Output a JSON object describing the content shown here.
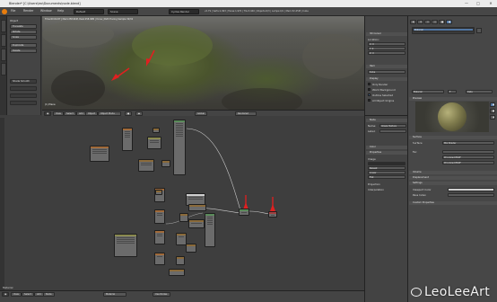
{
  "window": {
    "title": "Blender* [C:\\Users\\leo\\Documents\\node.blend]",
    "minimize": "—",
    "maximize": "□",
    "close": "✕"
  },
  "menubar": {
    "items": [
      "File",
      "Render",
      "Window",
      "Help"
    ],
    "layout": "Default",
    "scene": "Scene",
    "engine": "Cycles Render",
    "stats": "v2.79 | Verts:1,993 | Faces:1,970 | Tris:3,940 | Objects:0/3 | Lamps:0/1 | Mem:32.45M | Cube"
  },
  "tools_panel": {
    "object_label": "Object",
    "buttons": [
      "Translate",
      "Rotate",
      "Scale",
      "Duplicate",
      "Delete"
    ],
    "extra": "Shade Smooth"
  },
  "viewport": {
    "overlay_text": "Time:00:04.87 | Mem:258.96M, Peak:258.96M | Done | Path Tracing Sample 32/32",
    "object_name": "(1) Plane",
    "header": {
      "view": "View",
      "select": "Select",
      "add": "Add",
      "object": "Object",
      "mode": "Object Mode",
      "shading": "Rendered",
      "layers_label": "Global"
    }
  },
  "node_editor": {
    "header": {
      "view": "View",
      "select": "Select",
      "add": "Add",
      "node": "Node",
      "material": "Material",
      "use_nodes": "Use Nodes"
    },
    "bottom_label": "Material"
  },
  "outliner_panel": {
    "title": "3D Cursor",
    "location": "Location:",
    "x": "X: 0",
    "y": "Y: 0",
    "z": "Z: 0",
    "item": "Item",
    "cube": "Cube",
    "display": "Display",
    "only_render": "Only Render",
    "world_bg": "World Background",
    "outline": "Outline Selected",
    "all_edges": "All Object Origins"
  },
  "node_props": {
    "title": "Node",
    "name_label": "Name:",
    "name_value": "Image Texture",
    "label_label": "Label:",
    "color_label": "Color",
    "properties": "Properties",
    "image_label": "Image",
    "repeat": "Repeat",
    "linear": "Linear",
    "flat": "Flat",
    "projection_label": "Projection",
    "interp_label": "Interpolation"
  },
  "properties": {
    "tabs": [
      "Render",
      "Layers",
      "Scene",
      "World",
      "Object",
      "Material"
    ],
    "material_name": "Material",
    "preview": "Preview",
    "surface": "Surface",
    "surface_type": "Mix Shader",
    "fac": "Fac",
    "shader1": "Principled BSDF",
    "shader2": "Principled BSDF",
    "volume": "Volume",
    "displacement": "Displacement",
    "settings": "Settings",
    "custom": "Custom Properties",
    "viewport_color": "Viewport Color",
    "pass_index": "Pass Index",
    "f_label": "F",
    "data_label": "Data"
  },
  "watermark": "LeoLeeArt",
  "colors": {
    "accent_blue": "#5277a3",
    "arrow_red": "#e02020"
  }
}
